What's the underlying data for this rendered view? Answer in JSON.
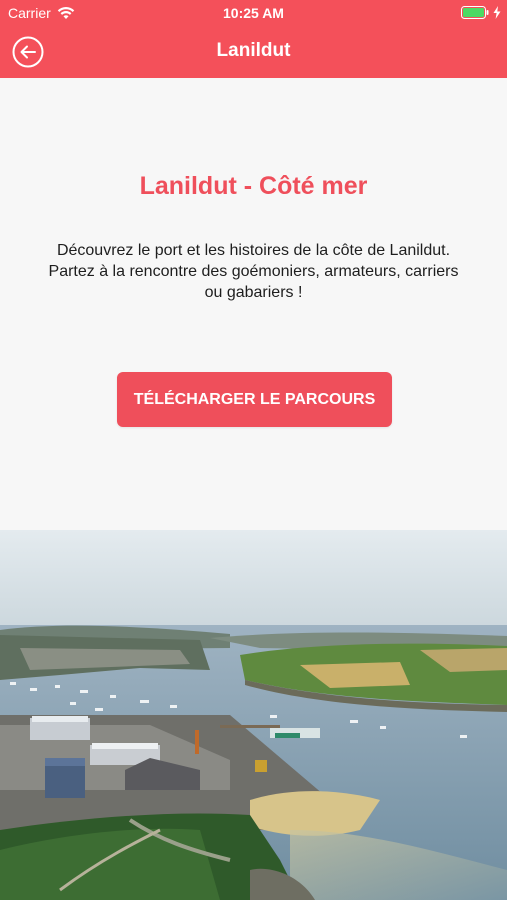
{
  "status_bar": {
    "carrier": "Carrier",
    "time": "10:25 AM",
    "icons": [
      "wifi-icon",
      "battery-icon",
      "charging-icon"
    ]
  },
  "nav": {
    "title": "Lanildut",
    "back_icon": "back-arrow-circle-icon"
  },
  "main": {
    "headline": "Lanildut - Côté mer",
    "description_lines": [
      "Découvrez le port et les histoires de la côte de Lanildut.",
      "Partez à la rencontre des goémoniers, armateurs, carriers ou gabariers !"
    ],
    "download_label": "TÉLÉCHARGER LE PARCOURS"
  },
  "photo": {
    "alt": "Aerial view of the port of Lanildut and the estuary"
  },
  "colors": {
    "accent": "#f4505a",
    "headline": "#ef4f5b",
    "background": "#f7f7f7",
    "text": "#1e1e1e"
  }
}
